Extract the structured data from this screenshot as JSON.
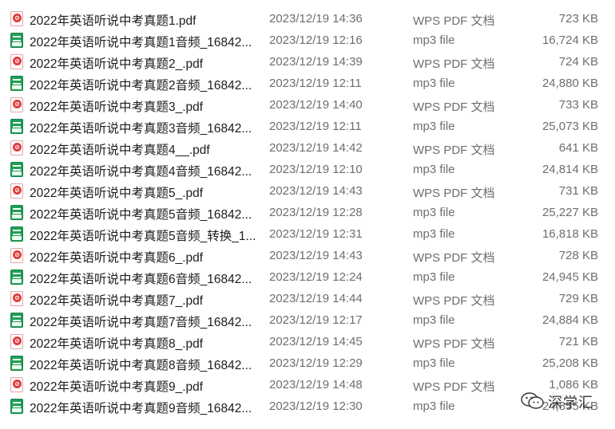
{
  "files": [
    {
      "name": "2022年英语听说中考真题1.pdf",
      "date": "2023/12/19 14:36",
      "type": "WPS PDF 文档",
      "size": "723 KB",
      "kind": "pdf"
    },
    {
      "name": "2022年英语听说中考真题1音频_16842...",
      "date": "2023/12/19 12:16",
      "type": "mp3 file",
      "size": "16,724 KB",
      "kind": "mp3"
    },
    {
      "name": "2022年英语听说中考真题2_.pdf",
      "date": "2023/12/19 14:39",
      "type": "WPS PDF 文档",
      "size": "724 KB",
      "kind": "pdf"
    },
    {
      "name": "2022年英语听说中考真题2音频_16842...",
      "date": "2023/12/19 12:11",
      "type": "mp3 file",
      "size": "24,880 KB",
      "kind": "mp3"
    },
    {
      "name": "2022年英语听说中考真题3_.pdf",
      "date": "2023/12/19 14:40",
      "type": "WPS PDF 文档",
      "size": "733 KB",
      "kind": "pdf"
    },
    {
      "name": "2022年英语听说中考真题3音频_16842...",
      "date": "2023/12/19 12:11",
      "type": "mp3 file",
      "size": "25,073 KB",
      "kind": "mp3"
    },
    {
      "name": "2022年英语听说中考真题4__.pdf",
      "date": "2023/12/19 14:42",
      "type": "WPS PDF 文档",
      "size": "641 KB",
      "kind": "pdf"
    },
    {
      "name": "2022年英语听说中考真题4音频_16842...",
      "date": "2023/12/19 12:10",
      "type": "mp3 file",
      "size": "24,814 KB",
      "kind": "mp3"
    },
    {
      "name": "2022年英语听说中考真题5_.pdf",
      "date": "2023/12/19 14:43",
      "type": "WPS PDF 文档",
      "size": "731 KB",
      "kind": "pdf"
    },
    {
      "name": "2022年英语听说中考真题5音频_16842...",
      "date": "2023/12/19 12:28",
      "type": "mp3 file",
      "size": "25,227 KB",
      "kind": "mp3"
    },
    {
      "name": "2022年英语听说中考真题5音频_转换_1...",
      "date": "2023/12/19 12:31",
      "type": "mp3 file",
      "size": "16,818 KB",
      "kind": "mp3"
    },
    {
      "name": "2022年英语听说中考真题6_.pdf",
      "date": "2023/12/19 14:43",
      "type": "WPS PDF 文档",
      "size": "728 KB",
      "kind": "pdf"
    },
    {
      "name": "2022年英语听说中考真题6音频_16842...",
      "date": "2023/12/19 12:24",
      "type": "mp3 file",
      "size": "24,945 KB",
      "kind": "mp3"
    },
    {
      "name": "2022年英语听说中考真题7_.pdf",
      "date": "2023/12/19 14:44",
      "type": "WPS PDF 文档",
      "size": "729 KB",
      "kind": "pdf"
    },
    {
      "name": "2022年英语听说中考真题7音频_16842...",
      "date": "2023/12/19 12:17",
      "type": "mp3 file",
      "size": "24,884 KB",
      "kind": "mp3"
    },
    {
      "name": "2022年英语听说中考真题8_.pdf",
      "date": "2023/12/19 14:45",
      "type": "WPS PDF 文档",
      "size": "721 KB",
      "kind": "pdf"
    },
    {
      "name": "2022年英语听说中考真题8音频_16842...",
      "date": "2023/12/19 12:29",
      "type": "mp3 file",
      "size": "25,208 KB",
      "kind": "mp3"
    },
    {
      "name": "2022年英语听说中考真题9_.pdf",
      "date": "2023/12/19 14:48",
      "type": "WPS PDF 文档",
      "size": "1,086 KB",
      "kind": "pdf"
    },
    {
      "name": "2022年英语听说中考真题9音频_16842...",
      "date": "2023/12/19 12:30",
      "type": "mp3 file",
      "size": "24,855 KB",
      "kind": "mp3"
    }
  ],
  "watermark": {
    "text": "深学汇",
    "icon": "wechat-logo-icon"
  },
  "colors": {
    "pdf_icon": "#e23a3a",
    "mp3_icon": "#1e9f54",
    "name_text": "#1c1c1c",
    "meta_text": "#6e6e6e"
  }
}
